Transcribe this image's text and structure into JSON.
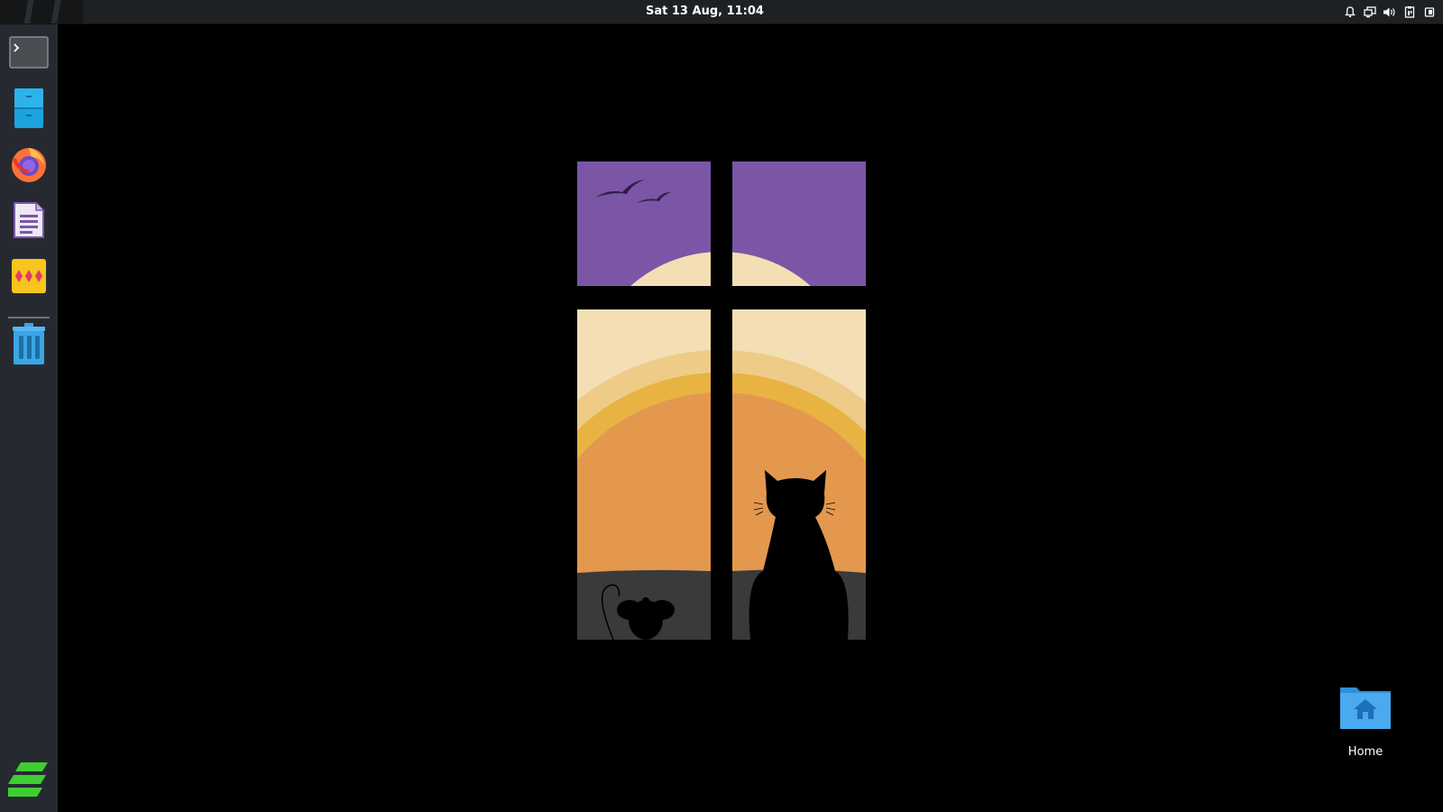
{
  "topbar": {
    "clock": "Sat 13 Aug, 11:04",
    "tray_icons": [
      "notification-bell-icon",
      "display-icon",
      "volume-icon",
      "clipboard-icon",
      "power-icon"
    ]
  },
  "dock": {
    "items": [
      {
        "name": "terminal",
        "icon": "terminal-icon"
      },
      {
        "name": "file-manager",
        "icon": "file-cabinet-icon"
      },
      {
        "name": "firefox",
        "icon": "firefox-icon"
      },
      {
        "name": "text-editor",
        "icon": "document-icon"
      },
      {
        "name": "app-launcher",
        "icon": "diamonds-app-icon"
      },
      {
        "name": "trash",
        "icon": "trash-icon"
      }
    ],
    "menu_icon": "menu-logo-icon"
  },
  "desktop": {
    "icons": [
      {
        "label": "Home",
        "icon": "home-folder-icon"
      }
    ]
  },
  "colors": {
    "sky": "#7b56a7",
    "sun_light": "#f3dfb3",
    "sun_mid": "#e8b342",
    "sun_core": "#e4984e",
    "sill": "#3a3a3a",
    "dock_bg": "#262a30",
    "topbar_bg": "#1e2124"
  }
}
